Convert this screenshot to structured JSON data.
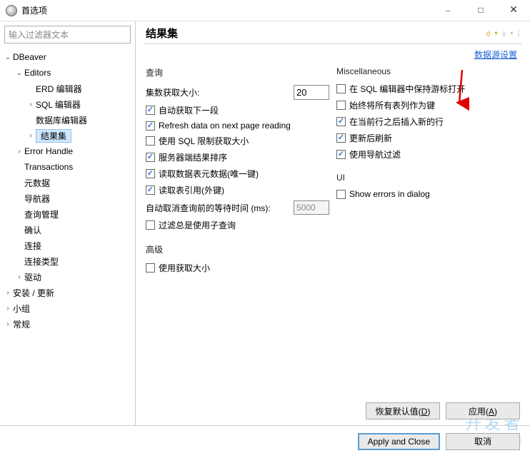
{
  "window": {
    "title": "首选项"
  },
  "filter": {
    "placeholder": "输入过滤器文本"
  },
  "tree": [
    {
      "label": "DBeaver",
      "level": 0,
      "expanded": true,
      "hasChildren": true,
      "selected": false
    },
    {
      "label": "Editors",
      "level": 1,
      "expanded": true,
      "hasChildren": true,
      "selected": false
    },
    {
      "label": "ERD 编辑器",
      "level": 2,
      "expanded": false,
      "hasChildren": false,
      "selected": false
    },
    {
      "label": "SQL 编辑器",
      "level": 2,
      "expanded": false,
      "hasChildren": true,
      "selected": false
    },
    {
      "label": "数据库编辑器",
      "level": 2,
      "expanded": false,
      "hasChildren": false,
      "selected": false
    },
    {
      "label": "结果集",
      "level": 2,
      "expanded": false,
      "hasChildren": true,
      "selected": true
    },
    {
      "label": "Error Handle",
      "level": 1,
      "expanded": false,
      "hasChildren": true,
      "selected": false
    },
    {
      "label": "Transactions",
      "level": 1,
      "expanded": false,
      "hasChildren": false,
      "selected": false
    },
    {
      "label": "元数据",
      "level": 1,
      "expanded": false,
      "hasChildren": false,
      "selected": false
    },
    {
      "label": "导航器",
      "level": 1,
      "expanded": false,
      "hasChildren": false,
      "selected": false
    },
    {
      "label": "查询管理",
      "level": 1,
      "expanded": false,
      "hasChildren": false,
      "selected": false
    },
    {
      "label": "确认",
      "level": 1,
      "expanded": false,
      "hasChildren": false,
      "selected": false
    },
    {
      "label": "连接",
      "level": 1,
      "expanded": false,
      "hasChildren": false,
      "selected": false
    },
    {
      "label": "连接类型",
      "level": 1,
      "expanded": false,
      "hasChildren": false,
      "selected": false
    },
    {
      "label": "驱动",
      "level": 1,
      "expanded": false,
      "hasChildren": true,
      "selected": false
    },
    {
      "label": "安装 / 更新",
      "level": 0,
      "expanded": false,
      "hasChildren": true,
      "selected": false
    },
    {
      "label": "小组",
      "level": 0,
      "expanded": false,
      "hasChildren": true,
      "selected": false
    },
    {
      "label": "常规",
      "level": 0,
      "expanded": false,
      "hasChildren": true,
      "selected": false
    }
  ],
  "page": {
    "title": "结果集",
    "datasource_link": "数据源设置",
    "groups": {
      "query": {
        "title": "查询",
        "fetch_size_label": "集数获取大小:",
        "fetch_size_value": "20",
        "auto_fetch": "自动获取下一段",
        "refresh_next": "Refresh data on next page reading",
        "use_sql_limit": "使用 SQL 限制获取大小",
        "server_sort": "服务器端结果排序",
        "read_meta": "读取数据表元数据(唯一键)",
        "read_ref": "读取表引用(外键)",
        "cancel_wait_label": "自动取消查询前的等待时间 (ms):",
        "cancel_wait_value": "5000",
        "filter_subquery": "过滤总是使用子查询"
      },
      "advanced": {
        "title": "高级",
        "use_fetch_size": "使用获取大小"
      },
      "misc": {
        "title": "Miscellaneous",
        "keep_cursor": "在 SQL 编辑器中保持游标打开",
        "all_tables_key": "始终将所有表列作为键",
        "insert_after": "在当前行之后插入新的行",
        "refresh_after_update": "更新后刷新",
        "use_nav_filter": "使用导航过滤"
      },
      "ui": {
        "title": "UI",
        "show_errors": "Show errors in dialog"
      }
    },
    "buttons": {
      "restore_defaults": "恢复默认值",
      "restore_defaults_key": "D",
      "apply": "应用",
      "apply_key": "A",
      "apply_close": "Apply and Close",
      "cancel": "取消"
    }
  },
  "watermark": {
    "main": "开发者",
    "sub": "DevZe.CoM"
  }
}
